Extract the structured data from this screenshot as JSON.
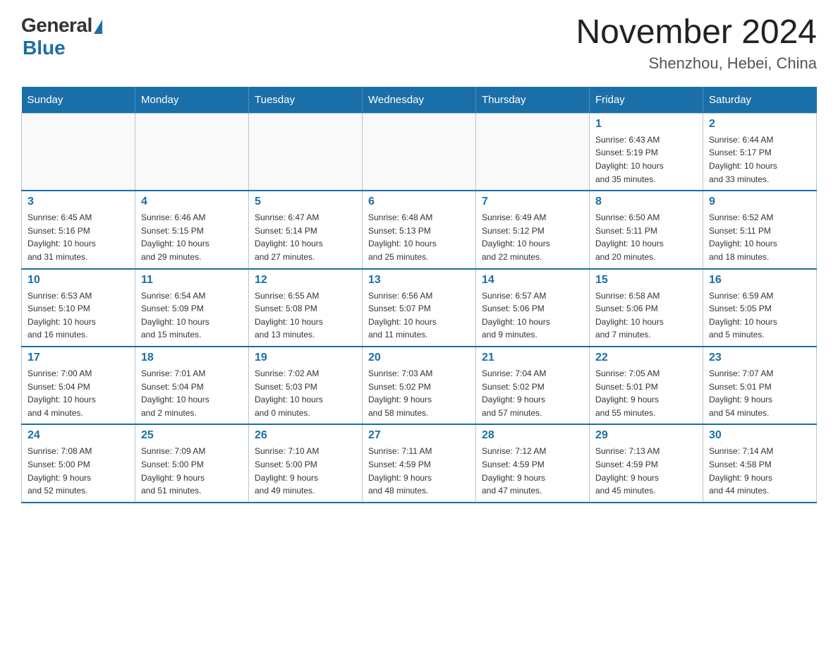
{
  "header": {
    "logo_general": "General",
    "logo_blue": "Blue",
    "month_year": "November 2024",
    "location": "Shenzhou, Hebei, China"
  },
  "days_of_week": [
    "Sunday",
    "Monday",
    "Tuesday",
    "Wednesday",
    "Thursday",
    "Friday",
    "Saturday"
  ],
  "weeks": [
    [
      {
        "day": "",
        "info": ""
      },
      {
        "day": "",
        "info": ""
      },
      {
        "day": "",
        "info": ""
      },
      {
        "day": "",
        "info": ""
      },
      {
        "day": "",
        "info": ""
      },
      {
        "day": "1",
        "info": "Sunrise: 6:43 AM\nSunset: 5:19 PM\nDaylight: 10 hours\nand 35 minutes."
      },
      {
        "day": "2",
        "info": "Sunrise: 6:44 AM\nSunset: 5:17 PM\nDaylight: 10 hours\nand 33 minutes."
      }
    ],
    [
      {
        "day": "3",
        "info": "Sunrise: 6:45 AM\nSunset: 5:16 PM\nDaylight: 10 hours\nand 31 minutes."
      },
      {
        "day": "4",
        "info": "Sunrise: 6:46 AM\nSunset: 5:15 PM\nDaylight: 10 hours\nand 29 minutes."
      },
      {
        "day": "5",
        "info": "Sunrise: 6:47 AM\nSunset: 5:14 PM\nDaylight: 10 hours\nand 27 minutes."
      },
      {
        "day": "6",
        "info": "Sunrise: 6:48 AM\nSunset: 5:13 PM\nDaylight: 10 hours\nand 25 minutes."
      },
      {
        "day": "7",
        "info": "Sunrise: 6:49 AM\nSunset: 5:12 PM\nDaylight: 10 hours\nand 22 minutes."
      },
      {
        "day": "8",
        "info": "Sunrise: 6:50 AM\nSunset: 5:11 PM\nDaylight: 10 hours\nand 20 minutes."
      },
      {
        "day": "9",
        "info": "Sunrise: 6:52 AM\nSunset: 5:11 PM\nDaylight: 10 hours\nand 18 minutes."
      }
    ],
    [
      {
        "day": "10",
        "info": "Sunrise: 6:53 AM\nSunset: 5:10 PM\nDaylight: 10 hours\nand 16 minutes."
      },
      {
        "day": "11",
        "info": "Sunrise: 6:54 AM\nSunset: 5:09 PM\nDaylight: 10 hours\nand 15 minutes."
      },
      {
        "day": "12",
        "info": "Sunrise: 6:55 AM\nSunset: 5:08 PM\nDaylight: 10 hours\nand 13 minutes."
      },
      {
        "day": "13",
        "info": "Sunrise: 6:56 AM\nSunset: 5:07 PM\nDaylight: 10 hours\nand 11 minutes."
      },
      {
        "day": "14",
        "info": "Sunrise: 6:57 AM\nSunset: 5:06 PM\nDaylight: 10 hours\nand 9 minutes."
      },
      {
        "day": "15",
        "info": "Sunrise: 6:58 AM\nSunset: 5:06 PM\nDaylight: 10 hours\nand 7 minutes."
      },
      {
        "day": "16",
        "info": "Sunrise: 6:59 AM\nSunset: 5:05 PM\nDaylight: 10 hours\nand 5 minutes."
      }
    ],
    [
      {
        "day": "17",
        "info": "Sunrise: 7:00 AM\nSunset: 5:04 PM\nDaylight: 10 hours\nand 4 minutes."
      },
      {
        "day": "18",
        "info": "Sunrise: 7:01 AM\nSunset: 5:04 PM\nDaylight: 10 hours\nand 2 minutes."
      },
      {
        "day": "19",
        "info": "Sunrise: 7:02 AM\nSunset: 5:03 PM\nDaylight: 10 hours\nand 0 minutes."
      },
      {
        "day": "20",
        "info": "Sunrise: 7:03 AM\nSunset: 5:02 PM\nDaylight: 9 hours\nand 58 minutes."
      },
      {
        "day": "21",
        "info": "Sunrise: 7:04 AM\nSunset: 5:02 PM\nDaylight: 9 hours\nand 57 minutes."
      },
      {
        "day": "22",
        "info": "Sunrise: 7:05 AM\nSunset: 5:01 PM\nDaylight: 9 hours\nand 55 minutes."
      },
      {
        "day": "23",
        "info": "Sunrise: 7:07 AM\nSunset: 5:01 PM\nDaylight: 9 hours\nand 54 minutes."
      }
    ],
    [
      {
        "day": "24",
        "info": "Sunrise: 7:08 AM\nSunset: 5:00 PM\nDaylight: 9 hours\nand 52 minutes."
      },
      {
        "day": "25",
        "info": "Sunrise: 7:09 AM\nSunset: 5:00 PM\nDaylight: 9 hours\nand 51 minutes."
      },
      {
        "day": "26",
        "info": "Sunrise: 7:10 AM\nSunset: 5:00 PM\nDaylight: 9 hours\nand 49 minutes."
      },
      {
        "day": "27",
        "info": "Sunrise: 7:11 AM\nSunset: 4:59 PM\nDaylight: 9 hours\nand 48 minutes."
      },
      {
        "day": "28",
        "info": "Sunrise: 7:12 AM\nSunset: 4:59 PM\nDaylight: 9 hours\nand 47 minutes."
      },
      {
        "day": "29",
        "info": "Sunrise: 7:13 AM\nSunset: 4:59 PM\nDaylight: 9 hours\nand 45 minutes."
      },
      {
        "day": "30",
        "info": "Sunrise: 7:14 AM\nSunset: 4:58 PM\nDaylight: 9 hours\nand 44 minutes."
      }
    ]
  ]
}
